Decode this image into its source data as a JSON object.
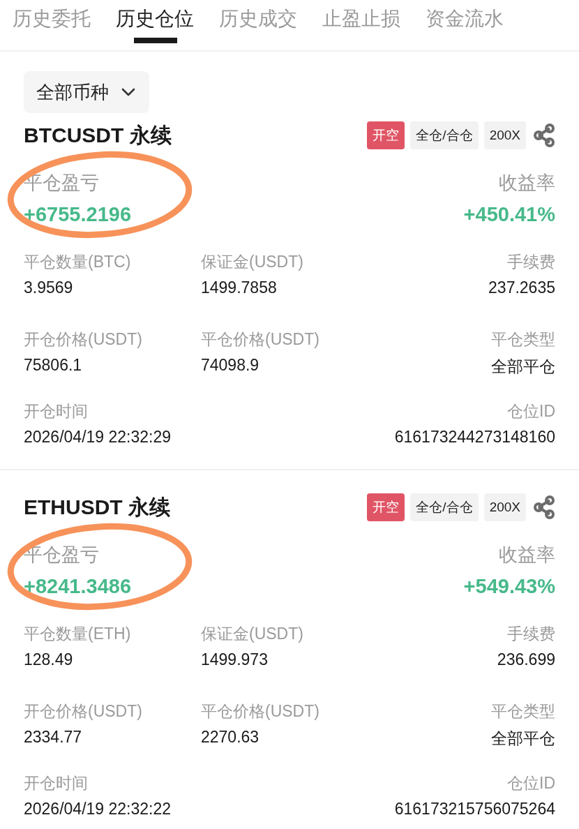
{
  "tabs": [
    {
      "label": "历史委托",
      "selected": false
    },
    {
      "label": "历史仓位",
      "selected": true
    },
    {
      "label": "历史成交",
      "selected": false
    },
    {
      "label": "止盈止损",
      "selected": false
    },
    {
      "label": "资金流水",
      "selected": false
    }
  ],
  "filter": {
    "label": "全部币种"
  },
  "positions": [
    {
      "title": "BTCUSDT 永续",
      "tags": [
        {
          "text": "开空",
          "kind": "side"
        },
        {
          "text": "全仓/合仓",
          "kind": "plain"
        },
        {
          "text": "200X",
          "kind": "plain"
        }
      ],
      "pnl_label": "平仓盈亏",
      "pnl_value": "+6755.2196",
      "roi_label": "收益率",
      "roi_value": "+450.41%",
      "circled": true,
      "rows": [
        [
          {
            "label": "平仓数量(BTC)",
            "value": "3.9569"
          },
          {
            "label": "保证金(USDT)",
            "value": "1499.7858"
          },
          {
            "label": "手续费",
            "value": "237.2635"
          }
        ],
        [
          {
            "label": "开仓价格(USDT)",
            "value": "75806.1"
          },
          {
            "label": "平仓价格(USDT)",
            "value": "74098.9"
          },
          {
            "label": "平仓类型",
            "value": "全部平仓"
          }
        ],
        [
          {
            "label": "开仓时间",
            "value": "2026/04/19 22:32:29"
          },
          null,
          {
            "label": "仓位ID",
            "value": "616173244273148160"
          }
        ]
      ]
    },
    {
      "title": "ETHUSDT 永续",
      "tags": [
        {
          "text": "开空",
          "kind": "side"
        },
        {
          "text": "全仓/合仓",
          "kind": "plain"
        },
        {
          "text": "200X",
          "kind": "plain"
        }
      ],
      "pnl_label": "平仓盈亏",
      "pnl_value": "+8241.3486",
      "roi_label": "收益率",
      "roi_value": "+549.43%",
      "circled": true,
      "rows": [
        [
          {
            "label": "平仓数量(ETH)",
            "value": "128.49"
          },
          {
            "label": "保证金(USDT)",
            "value": "1499.973"
          },
          {
            "label": "手续费",
            "value": "236.699"
          }
        ],
        [
          {
            "label": "开仓价格(USDT)",
            "value": "2334.77"
          },
          {
            "label": "平仓价格(USDT)",
            "value": "2270.63"
          },
          {
            "label": "平仓类型",
            "value": "全部平仓"
          }
        ],
        [
          {
            "label": "开仓时间",
            "value": "2026/04/19 22:32:22"
          },
          null,
          {
            "label": "仓位ID",
            "value": "616173215756075264"
          }
        ]
      ]
    }
  ]
}
